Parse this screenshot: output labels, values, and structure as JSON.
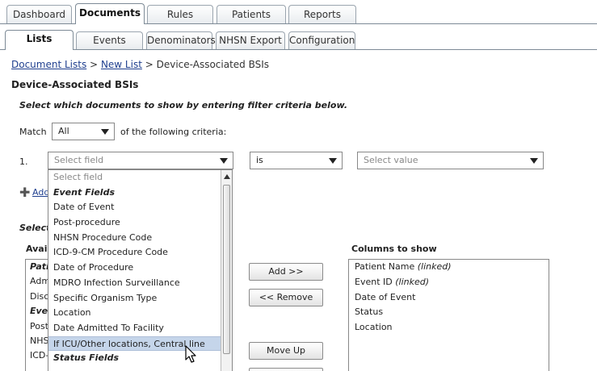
{
  "top_tabs": [
    {
      "label": "Dashboard"
    },
    {
      "label": "Documents"
    },
    {
      "label": "Rules"
    },
    {
      "label": "Patients"
    },
    {
      "label": "Reports"
    }
  ],
  "sub_tabs": [
    {
      "label": "Lists"
    },
    {
      "label": "Events"
    },
    {
      "label": "Denominators"
    },
    {
      "label": "NHSN Export"
    },
    {
      "label": "Configuration"
    }
  ],
  "breadcrumb": {
    "link1": "Document Lists",
    "sep1": ">",
    "link2": "New List",
    "sep2": ">",
    "current": "Device-Associated BSIs"
  },
  "page_title": "Device-Associated BSIs",
  "instruction": "Select which documents to show by entering filter criteria below.",
  "match": {
    "label": "Match",
    "value": "All",
    "suffix": "of the following criteria:"
  },
  "criteria": {
    "number": "1.",
    "field_placeholder": "Select field",
    "operator": "is",
    "value_placeholder": "Select value"
  },
  "dropdown_items": [
    {
      "label": "Select field",
      "kind": "hint"
    },
    {
      "label": "Event Fields",
      "kind": "group"
    },
    {
      "label": "Date of Event",
      "kind": "item"
    },
    {
      "label": "Post-procedure",
      "kind": "item"
    },
    {
      "label": "NHSN Procedure Code",
      "kind": "item"
    },
    {
      "label": "ICD-9-CM Procedure Code",
      "kind": "item"
    },
    {
      "label": "Date of Procedure",
      "kind": "item"
    },
    {
      "label": "MDRO Infection Surveillance",
      "kind": "item"
    },
    {
      "label": "Specific Organism Type",
      "kind": "item"
    },
    {
      "label": "Location",
      "kind": "item"
    },
    {
      "label": "Date Admitted To Facility",
      "kind": "item"
    },
    {
      "label": "If ICU/Other locations, Central line",
      "kind": "selected"
    },
    {
      "label": "Status Fields",
      "kind": "group"
    }
  ],
  "add_link": "Add",
  "partial_text": "Select c",
  "available": {
    "label": "Avail",
    "items": [
      {
        "label": "Patie",
        "kind": "group"
      },
      {
        "label": "Adm",
        "kind": "item"
      },
      {
        "label": "Disc",
        "kind": "item"
      },
      {
        "label": "Even",
        "kind": "group"
      },
      {
        "label": "Post",
        "kind": "item"
      },
      {
        "label": "NHS",
        "kind": "item"
      },
      {
        "label": "ICD-",
        "kind": "item"
      }
    ]
  },
  "buttons": {
    "add": "Add >>",
    "remove": "<< Remove",
    "move_up": "Move Up"
  },
  "columns": {
    "label": "Columns to show",
    "items": [
      {
        "text": "Patient Name",
        "note": "(linked)"
      },
      {
        "text": "Event ID",
        "note": "(linked)"
      },
      {
        "text": "Date of Event",
        "note": ""
      },
      {
        "text": "Status",
        "note": ""
      },
      {
        "text": "Location",
        "note": ""
      }
    ]
  }
}
